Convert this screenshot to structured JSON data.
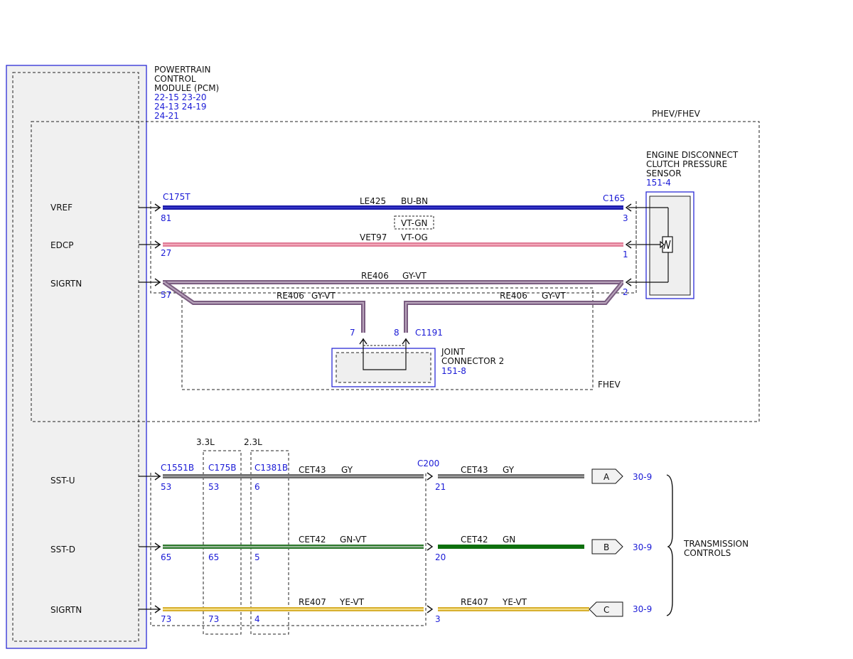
{
  "pcm": {
    "title": [
      "POWERTRAIN",
      "CONTROL",
      "MODULE (PCM)"
    ],
    "refs": [
      "22-15 23-20",
      "24-13 24-19",
      "24-21"
    ]
  },
  "pins": {
    "vref": "VREF",
    "edcp": "EDCP",
    "sigrtn_top": "SIGRTN",
    "sst_u": "SST-U",
    "sst_d": "SST-D",
    "sigrtn_bottom": "SIGRTN"
  },
  "zones": {
    "phev_fhev": "PHEV/FHEV",
    "fhev": "FHEV",
    "engine_3_3": "3.3L",
    "engine_2_3": "2.3L"
  },
  "connectors": {
    "c175t": "C175T",
    "c165": "C165",
    "c1191": "C1191",
    "c1551b": "C1551B",
    "c175b": "C175B",
    "c1381b": "C1381B",
    "c200": "C200"
  },
  "pin_numbers": {
    "p81": "81",
    "p27": "27",
    "p57": "57",
    "p3": "3",
    "p1": "1",
    "p2": "2",
    "p7": "7",
    "p8": "8",
    "sstu_53a": "53",
    "sstu_53b": "53",
    "sstu_6": "6",
    "sstu_21": "21",
    "sstd_65a": "65",
    "sstd_65b": "65",
    "sstd_5": "5",
    "sstd_20": "20",
    "sig_73a": "73",
    "sig_73b": "73",
    "sig_4": "4",
    "sig_3": "3"
  },
  "wires": {
    "le425": {
      "circuit": "LE425",
      "color": "BU-BN",
      "hex": "#1a1aa8"
    },
    "vet97": {
      "circuit": "VET97",
      "color": "VT-OG",
      "alt_color": "VT-GN",
      "hex": "#e88aa0"
    },
    "re406": {
      "circuit": "RE406",
      "color": "GY-VT",
      "hex": "#9a7a9e"
    },
    "re406_left": {
      "circuit": "RE406",
      "color": "GY-VT"
    },
    "re406_right": {
      "circuit": "RE406",
      "color": "GY-VT"
    },
    "cet43_a": {
      "circuit": "CET43",
      "color": "GY",
      "hex": "#7a7a7a"
    },
    "cet43_b": {
      "circuit": "CET43",
      "color": "GY"
    },
    "cet42_a": {
      "circuit": "CET42",
      "color": "GN-VT",
      "hex": "#3a8a3a"
    },
    "cet42_b": {
      "circuit": "CET42",
      "color": "GN",
      "hex": "#0f7a0f"
    },
    "re407_a": {
      "circuit": "RE407",
      "color": "YE-VT",
      "hex": "#e8c84a"
    },
    "re407_b": {
      "circuit": "RE407",
      "color": "YE-VT"
    }
  },
  "sensor": {
    "title": [
      "ENGINE DISCONNECT",
      "CLUTCH PRESSURE",
      "SENSOR"
    ],
    "ref": "151-4"
  },
  "joint": {
    "title": [
      "JOINT",
      "CONNECTOR 2"
    ],
    "ref": "151-8"
  },
  "tags": {
    "a": {
      "letter": "A",
      "ref": "30-9"
    },
    "b": {
      "letter": "B",
      "ref": "30-9"
    },
    "c": {
      "letter": "C",
      "ref": "30-9"
    }
  },
  "transmission": [
    "TRANSMISSION",
    "CONTROLS"
  ]
}
